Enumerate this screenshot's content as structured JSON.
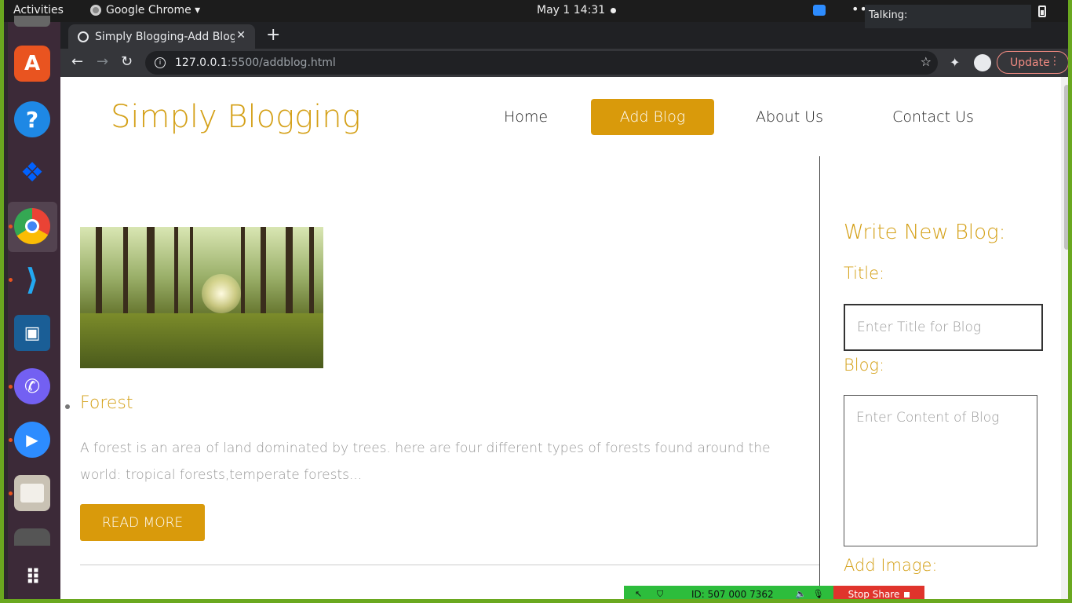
{
  "topbar": {
    "activities": "Activities",
    "app_name": "Google Chrome ▾",
    "clock": "May 1  14:31",
    "talking": "Talking:"
  },
  "dock": {
    "apps": [
      "ubuntu-software",
      "help",
      "dropbox",
      "google-chrome",
      "vscode",
      "virtualbox",
      "viber",
      "zoom",
      "files",
      "show-apps"
    ]
  },
  "browser": {
    "tab_title": "Simply Blogging-Add Blog",
    "url_host": "127.0.0.1",
    "url_path": ":5500/addblog.html",
    "update_label": "Update"
  },
  "site": {
    "logo": "Simply Blogging",
    "nav": [
      "Home",
      "Add Blog",
      "About Us",
      "Contact Us"
    ],
    "active_nav": "Add Blog",
    "accent_color": "#d99a0b"
  },
  "post": {
    "title": "Forest",
    "excerpt": "A forest is an area of land dominated by trees. here are four different types of forests found around the world: tropical forests,temperate forests...",
    "read_more": "READ MORE"
  },
  "form": {
    "heading": "Write New Blog:",
    "title_label": "Title:",
    "title_placeholder": "Enter Title for Blog",
    "blog_label": "Blog:",
    "blog_placeholder": "Enter Content of Blog",
    "image_label": "Add Image:"
  },
  "anydesk": {
    "id": "ID: 507 000 7362",
    "stop_label": "Stop Share"
  }
}
